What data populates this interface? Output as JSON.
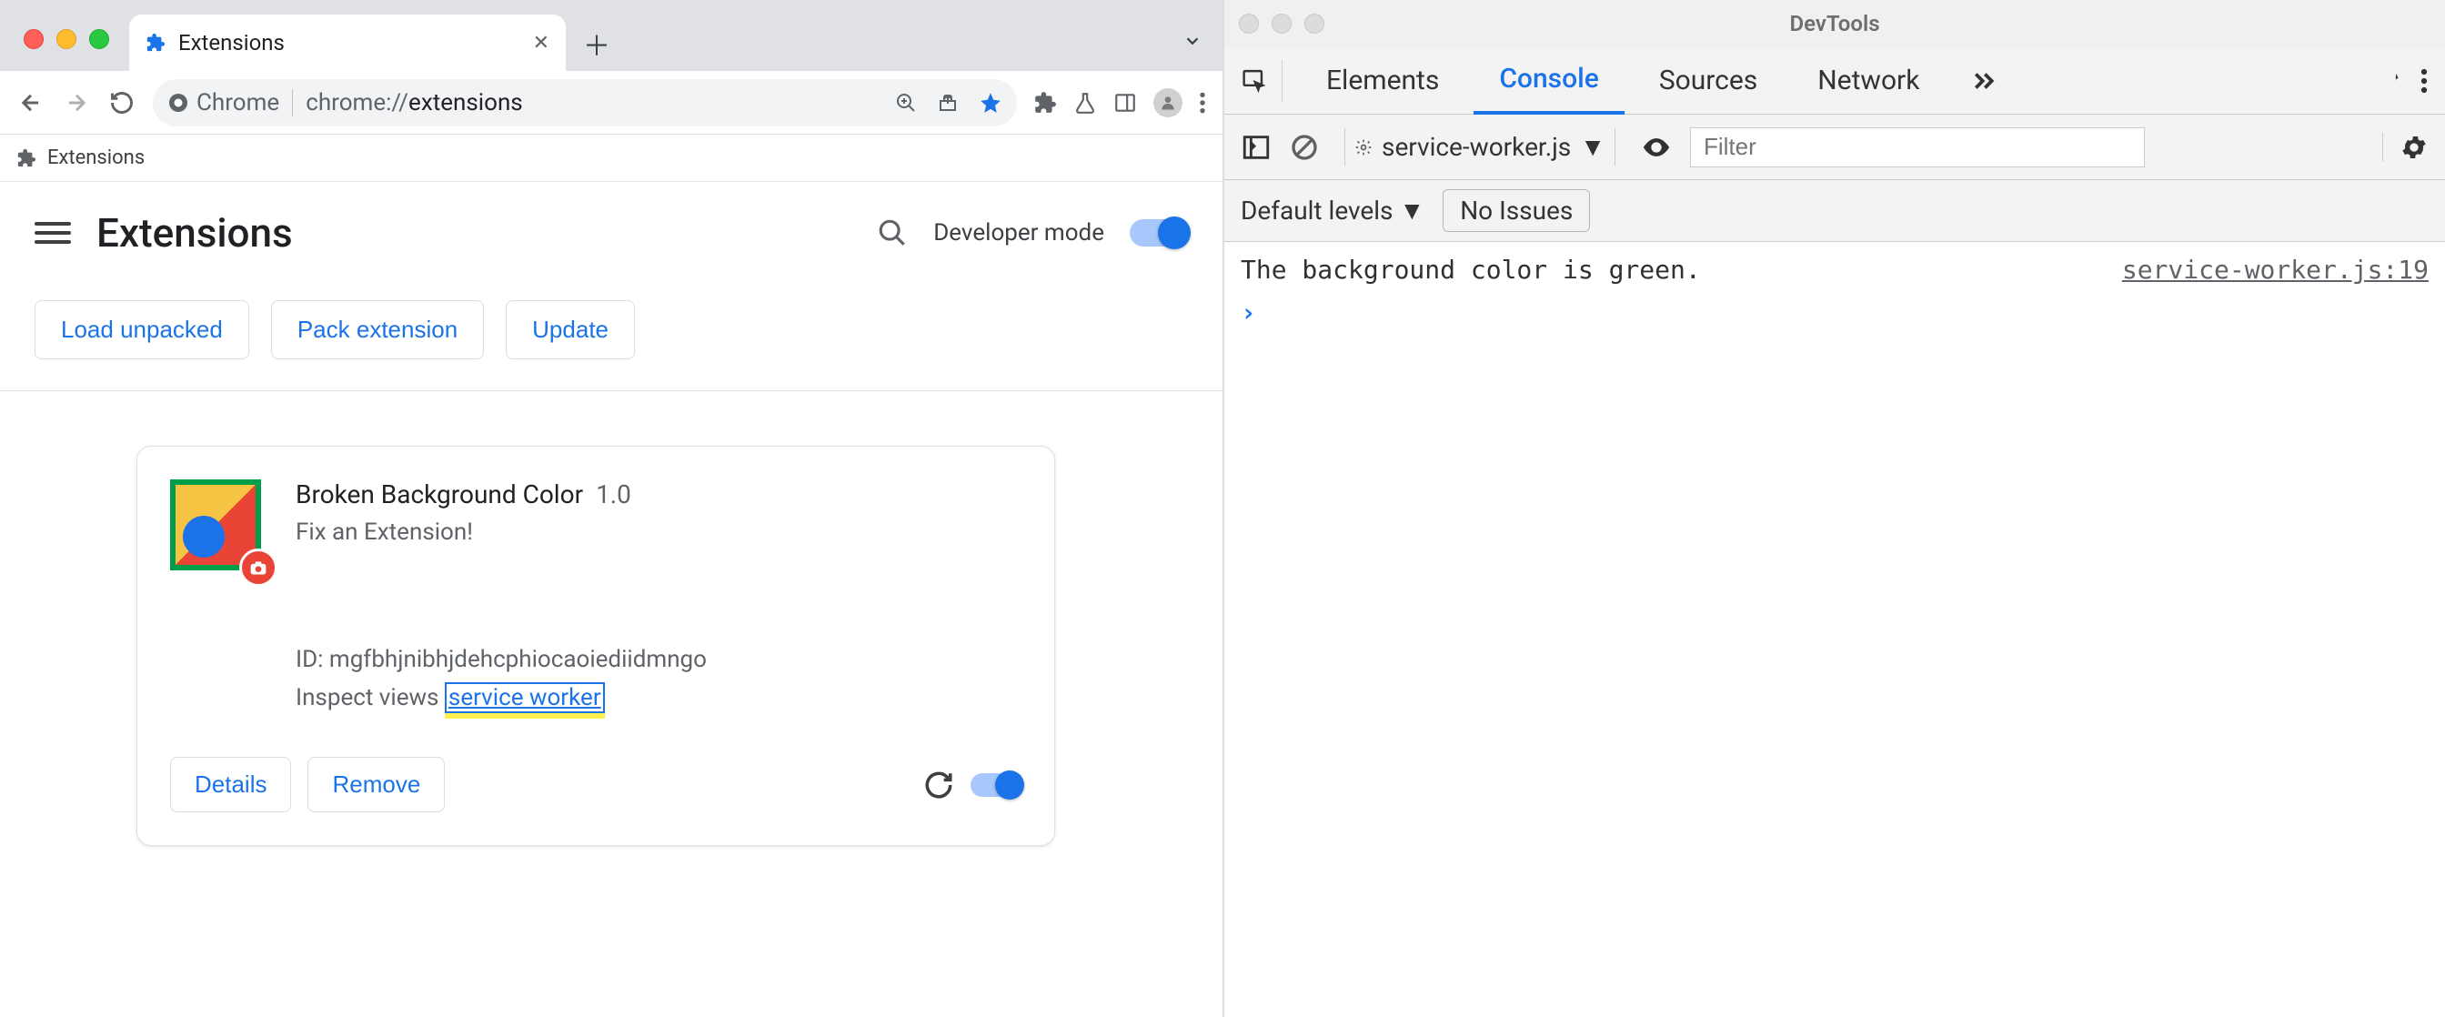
{
  "chrome": {
    "tab": {
      "title": "Extensions"
    },
    "omnibox": {
      "chip_label": "Chrome",
      "url_prefix": "chrome://",
      "url_path": "extensions"
    },
    "bookmarks": {
      "item1": "Extensions"
    }
  },
  "ext_page": {
    "title": "Extensions",
    "dev_mode_label": "Developer mode",
    "buttons": {
      "load_unpacked": "Load unpacked",
      "pack_extension": "Pack extension",
      "update": "Update"
    },
    "card": {
      "name": "Broken Background Color",
      "version": "1.0",
      "description": "Fix an Extension!",
      "id_label": "ID: ",
      "id_value": "mgfbhjnibhjdehcphiocaoiediidmngo",
      "inspect_label": "Inspect views ",
      "inspect_link": "service worker",
      "details_btn": "Details",
      "remove_btn": "Remove"
    }
  },
  "devtools": {
    "title": "DevTools",
    "tabs": {
      "elements": "Elements",
      "console": "Console",
      "sources": "Sources",
      "network": "Network"
    },
    "console_toolbar": {
      "context": "service-worker.js",
      "filter_placeholder": "Filter",
      "levels": "Default levels",
      "issues": "No Issues"
    },
    "log": {
      "message": "The background color is green.",
      "source": "service-worker.js:19"
    }
  }
}
